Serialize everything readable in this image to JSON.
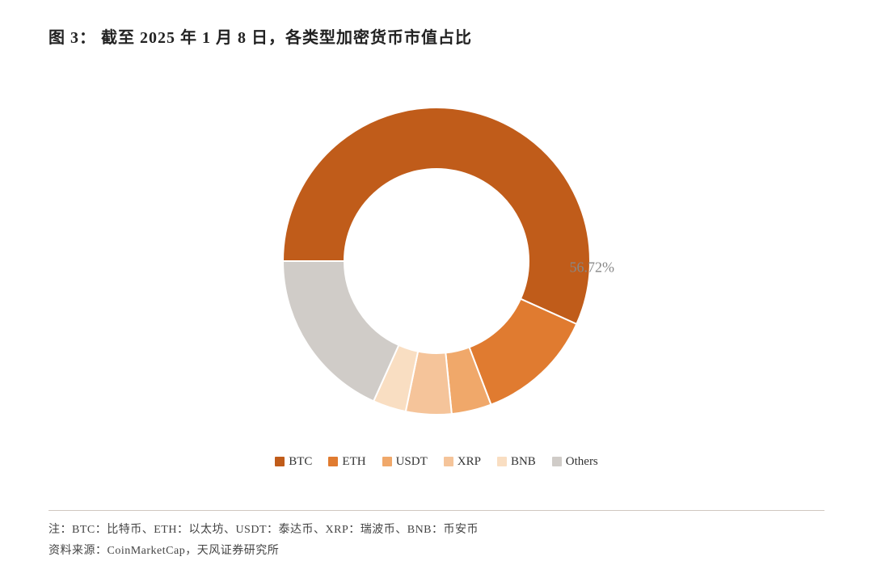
{
  "title": "图 3：  截至 2025 年 1 月 8 日，各类型加密货币市值占比",
  "chart": {
    "segments": [
      {
        "label": "BTC",
        "value": 56.72,
        "color": "#C05C1A",
        "startAngle": -90,
        "sweep": 204.19
      },
      {
        "label": "ETH",
        "value": 12.5,
        "color": "#E07B30",
        "startAngle": 114.19,
        "sweep": 45.0
      },
      {
        "label": "USDT",
        "value": 4.2,
        "color": "#F0A86A",
        "startAngle": 159.19,
        "sweep": 15.12
      },
      {
        "label": "XRP",
        "value": 4.8,
        "color": "#F5C49A",
        "startAngle": 174.31,
        "sweep": 17.28
      },
      {
        "label": "BNB",
        "value": 3.5,
        "color": "#F9DEC2",
        "startAngle": 191.59,
        "sweep": 12.6
      },
      {
        "label": "Others",
        "value": 18.28,
        "color": "#D0CCC8",
        "startAngle": 204.19,
        "sweep": 65.81
      }
    ],
    "percentage_label": "56.72%",
    "inner_radius_ratio": 0.6
  },
  "legend": [
    {
      "label": "BTC",
      "color": "#C05C1A"
    },
    {
      "label": "ETH",
      "color": "#E07B30"
    },
    {
      "label": "USDT",
      "color": "#F0A86A"
    },
    {
      "label": "XRP",
      "color": "#F5C49A"
    },
    {
      "label": "BNB",
      "color": "#F9DEC2"
    },
    {
      "label": "Others",
      "color": "#D0CCC8"
    }
  ],
  "footer": {
    "note": "注：BTC：比特币、ETH：以太坊、USDT：泰达币、XRP：瑞波币、BNB：币安币",
    "source": "资料来源：CoinMarketCap，天风证券研究所"
  }
}
